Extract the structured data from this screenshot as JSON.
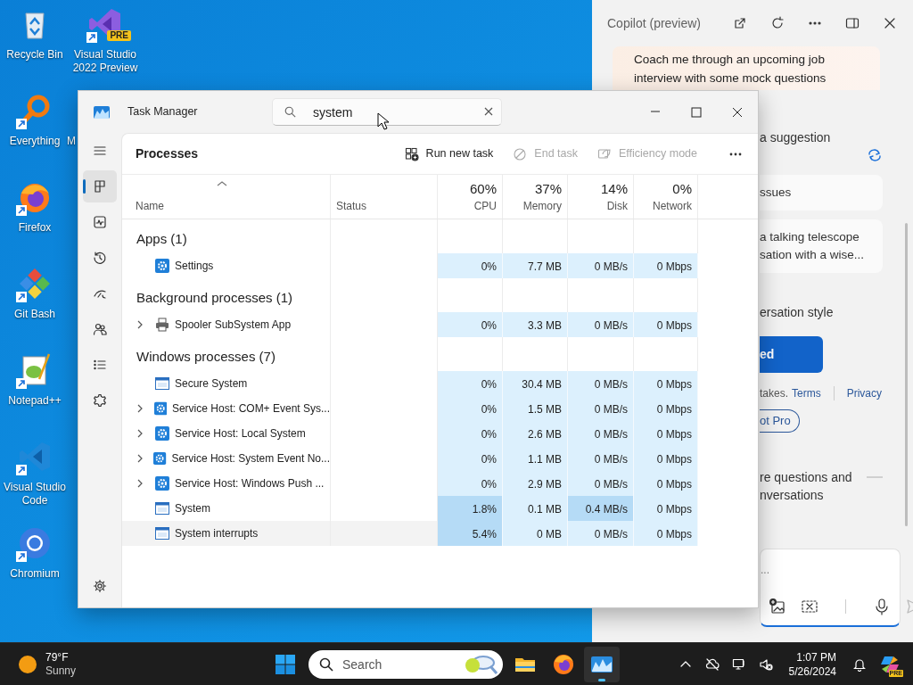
{
  "desktop": {
    "columns": [
      [
        {
          "label": "Recycle Bin",
          "kind": "recycle",
          "shortcut": false
        },
        {
          "label": "Everything",
          "kind": "everything",
          "shortcut": true
        },
        {
          "label": "Firefox",
          "kind": "firefox",
          "shortcut": true
        },
        {
          "label": "Git Bash",
          "kind": "gitbash",
          "shortcut": true
        },
        {
          "label": "Notepad++",
          "kind": "notepadpp",
          "shortcut": true
        },
        {
          "label": "Visual Studio Code",
          "kind": "vscode",
          "shortcut": true
        },
        {
          "label": "Chromium",
          "kind": "chromium",
          "shortcut": true
        }
      ],
      [
        {
          "label": "Visual Studio 2022 Preview",
          "kind": "vspreview",
          "shortcut": true,
          "badge": "PRE"
        },
        {
          "label": "M",
          "kind": "hidden"
        }
      ]
    ]
  },
  "copilot": {
    "title": "Copilot (preview)",
    "prompt": "Coach me through an upcoming job interview with some mock questions",
    "suggestion_label": "a suggestion",
    "suggestions": [
      [
        "ssues"
      ],
      [
        "a talking telescope",
        "sation with a wise..."
      ]
    ],
    "style_label": "ersation style",
    "style_button": "ed",
    "disclaimer": "takes.",
    "links": [
      "Terms",
      "Privacy"
    ],
    "pro_button": "ot Pro",
    "footer_lines": [
      "re questions and",
      "nversations"
    ],
    "input": {
      "placeholder": "..."
    }
  },
  "task_manager": {
    "title": "Task Manager",
    "search": {
      "value": "system"
    },
    "nav": [
      {
        "kind": "menu",
        "selected": false
      },
      {
        "kind": "processes",
        "selected": true
      },
      {
        "kind": "performance",
        "selected": false
      },
      {
        "kind": "history",
        "selected": false
      },
      {
        "kind": "startup",
        "selected": false
      },
      {
        "kind": "users",
        "selected": false
      },
      {
        "kind": "details",
        "selected": false
      },
      {
        "kind": "services",
        "selected": false
      }
    ],
    "nav_footer": {
      "kind": "settings",
      "selected": false
    },
    "page_title": "Processes",
    "toolbar": [
      {
        "label": "Run new task",
        "kind": "run",
        "disabled": false
      },
      {
        "label": "End task",
        "kind": "end",
        "disabled": true
      },
      {
        "label": "Efficiency mode",
        "kind": "efficiency",
        "disabled": true
      }
    ],
    "columns": [
      {
        "label": "Name",
        "sorted": true
      },
      {
        "label": "Status",
        "sorted": false
      },
      {
        "label": "CPU",
        "total": "60%",
        "sorted": false
      },
      {
        "label": "Memory",
        "total": "37%",
        "sorted": false
      },
      {
        "label": "Disk",
        "total": "14%",
        "sorted": false
      },
      {
        "label": "Network",
        "total": "0%",
        "sorted": false
      }
    ],
    "groups": [
      {
        "title": "Apps (1)",
        "rows": [
          {
            "name": "Settings",
            "kind": "gear",
            "expandable": false,
            "hovered": false,
            "values": [
              "0%",
              "7.7 MB",
              "0 MB/s",
              "0 Mbps"
            ],
            "heat": [
              false,
              false,
              false,
              false
            ]
          }
        ]
      },
      {
        "title": "Background processes (1)",
        "rows": [
          {
            "name": "Spooler SubSystem App",
            "kind": "printer",
            "expandable": true,
            "hovered": false,
            "values": [
              "0%",
              "3.3 MB",
              "0 MB/s",
              "0 Mbps"
            ],
            "heat": [
              false,
              false,
              false,
              false
            ]
          }
        ]
      },
      {
        "title": "Windows processes (7)",
        "rows": [
          {
            "name": "Secure System",
            "kind": "window",
            "expandable": false,
            "hovered": false,
            "values": [
              "0%",
              "30.4 MB",
              "0 MB/s",
              "0 Mbps"
            ],
            "heat": [
              false,
              false,
              false,
              false
            ]
          },
          {
            "name": "Service Host: COM+ Event Sys...",
            "kind": "gear",
            "expandable": true,
            "hovered": false,
            "values": [
              "0%",
              "1.5 MB",
              "0 MB/s",
              "0 Mbps"
            ],
            "heat": [
              false,
              false,
              false,
              false
            ]
          },
          {
            "name": "Service Host: Local System",
            "kind": "gear",
            "expandable": true,
            "hovered": false,
            "values": [
              "0%",
              "2.6 MB",
              "0 MB/s",
              "0 Mbps"
            ],
            "heat": [
              false,
              false,
              false,
              false
            ]
          },
          {
            "name": "Service Host: System Event No...",
            "kind": "gear",
            "expandable": true,
            "hovered": false,
            "values": [
              "0%",
              "1.1 MB",
              "0 MB/s",
              "0 Mbps"
            ],
            "heat": [
              false,
              false,
              false,
              false
            ]
          },
          {
            "name": "Service Host: Windows Push ...",
            "kind": "gear",
            "expandable": true,
            "hovered": false,
            "values": [
              "0%",
              "2.9 MB",
              "0 MB/s",
              "0 Mbps"
            ],
            "heat": [
              false,
              false,
              false,
              false
            ]
          },
          {
            "name": "System",
            "kind": "window",
            "expandable": false,
            "hovered": false,
            "values": [
              "1.8%",
              "0.1 MB",
              "0.4 MB/s",
              "0 Mbps"
            ],
            "heat": [
              true,
              false,
              true,
              false
            ]
          },
          {
            "name": "System interrupts",
            "kind": "window",
            "expandable": false,
            "hovered": true,
            "values": [
              "5.4%",
              "0 MB",
              "0 MB/s",
              "0 Mbps"
            ],
            "heat": [
              true,
              false,
              false,
              false
            ]
          }
        ]
      }
    ]
  },
  "taskbar": {
    "weather": {
      "temp": "79°F",
      "condition": "Sunny"
    },
    "search": {
      "placeholder": "Search"
    },
    "apps": [
      {
        "kind": "explorer",
        "active": false
      },
      {
        "kind": "firefox",
        "active": false
      },
      {
        "kind": "taskmanager",
        "active": true
      }
    ],
    "clock": {
      "time": "1:07 PM",
      "date": "5/26/2024"
    },
    "copilot": {
      "badge": "PRE"
    }
  }
}
